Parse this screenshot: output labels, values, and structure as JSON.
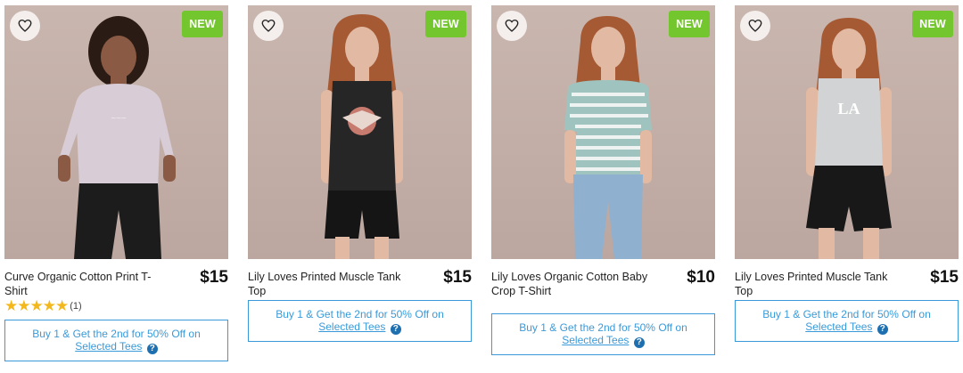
{
  "products": [
    {
      "badge": "NEW",
      "title": "Curve Organic Cotton Print T-Shirt",
      "price": "$15",
      "rating": {
        "stars": 5,
        "count_text": "(1)"
      },
      "promo": {
        "text": "Buy 1 & Get the 2nd for 50% Off on ",
        "link": "Selected Tees"
      },
      "colors": {
        "top": "#d8cdd6",
        "bottom": "#1c1c1c",
        "hair": "#2a1b14",
        "skin": "#8a5a45"
      }
    },
    {
      "badge": "NEW",
      "title": "Lily Loves Printed Muscle Tank Top",
      "price": "$15",
      "promo": {
        "text": "Buy 1 & Get the 2nd for 50% Off on ",
        "link": "Selected Tees"
      },
      "colors": {
        "top": "#262626",
        "bottom": "#151515",
        "hair": "#a65a34",
        "skin": "#e2b9a2"
      }
    },
    {
      "badge": "NEW",
      "title": "Lily Loves Organic Cotton Baby Crop T-Shirt",
      "price": "$10",
      "promo": {
        "text": "Buy 1 & Get the 2nd for 50% Off on ",
        "link": "Selected Tees"
      },
      "colors": {
        "top": "#9fc4c0",
        "bottom": "#8fb0cf",
        "hair": "#a65a34",
        "skin": "#e2b9a2"
      }
    },
    {
      "badge": "NEW",
      "title": "Lily Loves Printed Muscle Tank Top",
      "price": "$15",
      "promo": {
        "text": "Buy 1 & Get the 2nd for 50% Off on ",
        "link": "Selected Tees"
      },
      "colors": {
        "top": "#d2d3d4",
        "bottom": "#181818",
        "hair": "#a65a34",
        "skin": "#e2b9a2"
      }
    }
  ],
  "icons": {
    "wishlist": "heart-outline-icon",
    "help": "question-circle-icon"
  },
  "accent": "#3a9ad9",
  "badge_color": "#74c62f"
}
